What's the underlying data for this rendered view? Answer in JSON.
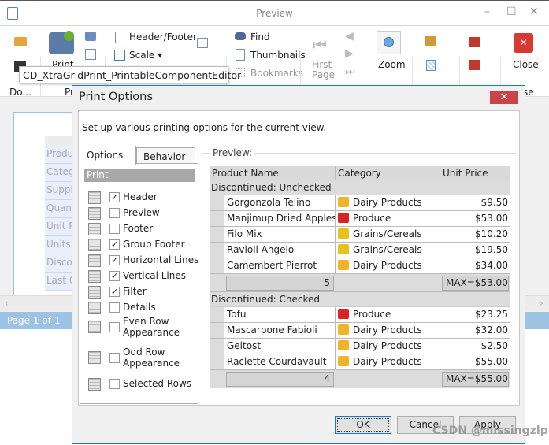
{
  "window": {
    "title": "Preview",
    "min": "–",
    "max": "☐",
    "close": "✕"
  },
  "ribbon": {
    "document_group": "Do...",
    "print_group": "Pr",
    "close_group": "se",
    "print": "Print",
    "header_footer": "Header/Footer",
    "scale": "Scale",
    "find": "Find",
    "thumbnails": "Thumbnails",
    "bookmarks": "Bookmarks",
    "first_page": "First Page",
    "zoom": "Zoom",
    "close": "Close"
  },
  "tooltip": "CD_XtraGridPrint_PrintableComponentEditor",
  "background": {
    "page_cells": [
      "Produ",
      "Catego",
      "Suppli",
      "Quanti",
      "Unit Pr",
      "Units i",
      "Discon",
      "Last O"
    ],
    "status": "Page 1 of 1"
  },
  "dialog": {
    "title": "Print Options",
    "close": "✕",
    "description": "Set up various printing options for the current view.",
    "tabs": [
      "Options",
      "Behavior"
    ],
    "print_header": "Print",
    "options": [
      {
        "label": "Header",
        "checked": true
      },
      {
        "label": "Preview",
        "checked": false
      },
      {
        "label": "Footer",
        "checked": false
      },
      {
        "label": "Group Footer",
        "checked": true
      },
      {
        "label": "Horizontal Lines",
        "checked": true
      },
      {
        "label": "Vertical Lines",
        "checked": true
      },
      {
        "label": "Filter",
        "checked": true
      },
      {
        "label": "Details",
        "checked": false
      },
      {
        "label": "Even Row",
        "label2": "Appearance",
        "checked": false
      },
      {
        "label": "Odd Row",
        "label2": "Appearance",
        "checked": false
      },
      {
        "label": "Selected Rows",
        "checked": false
      }
    ],
    "preview_label": "Preview:",
    "grid": {
      "columns": [
        "Product Name",
        "Category",
        "Unit Price"
      ],
      "groups": [
        {
          "title": "Discontinued: Unchecked",
          "rows": [
            [
              "Gorgonzola Telino",
              "Dairy Products",
              "$9.50"
            ],
            [
              "Manjimup Dried Apples",
              "Produce",
              "$53.00"
            ],
            [
              "Filo Mix",
              "Grains/Cereals",
              "$10.20"
            ],
            [
              "Ravioli Angelo",
              "Grains/Cereals",
              "$19.50"
            ],
            [
              "Camembert Pierrot",
              "Dairy Products",
              "$34.00"
            ]
          ],
          "count": "5",
          "max": "MAX=$53.00"
        },
        {
          "title": "Discontinued: Checked",
          "rows": [
            [
              "Tofu",
              "Produce",
              "$23.25"
            ],
            [
              "Mascarpone Fabioli",
              "Dairy Products",
              "$32.00"
            ],
            [
              "Geitost",
              "Dairy Products",
              "$2.50"
            ],
            [
              "Raclette Courdavault",
              "Dairy Products",
              "$55.00"
            ]
          ],
          "count": "4",
          "max": "MAX=$55.00"
        }
      ]
    },
    "buttons": {
      "ok": "OK",
      "cancel": "Cancel",
      "apply": "Apply"
    }
  },
  "watermark": "CSDN @missingzlp",
  "colors": {
    "accent": "#1979ca",
    "close_red": "#c9444a",
    "status": "#9cc3e3"
  }
}
